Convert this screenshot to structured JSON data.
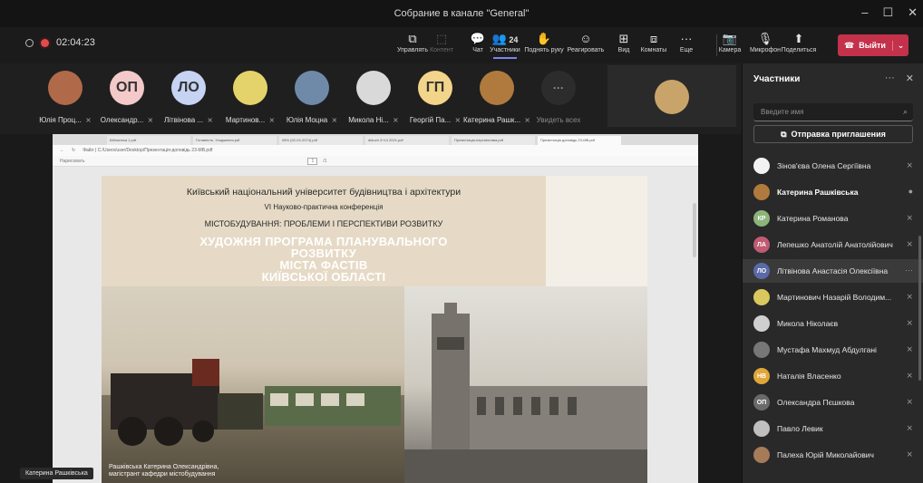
{
  "window": {
    "title": "Собрание в канале \"General\"",
    "controls": [
      "–",
      "☐",
      "✕"
    ]
  },
  "toolbar": {
    "timer": "02:04:23",
    "buttons": [
      {
        "label": "Управлять",
        "icon": "⧉",
        "active": false,
        "dim": false
      },
      {
        "label": "Контент",
        "icon": "⬚",
        "active": false,
        "dim": true
      },
      {
        "label": "Чат",
        "icon": "💬",
        "active": false,
        "dim": false
      },
      {
        "label": "Участники",
        "icon": "👥",
        "count": "24",
        "active": true,
        "dim": false
      },
      {
        "label": "Поднять руку",
        "icon": "✋",
        "active": false,
        "dim": false
      },
      {
        "label": "Реагировать",
        "icon": "☺",
        "active": false,
        "dim": false
      },
      {
        "label": "Вид",
        "icon": "⊞",
        "active": false,
        "dim": false
      },
      {
        "label": "Комнаты",
        "icon": "⧈",
        "active": false,
        "dim": false
      },
      {
        "label": "Еще",
        "icon": "···",
        "active": false,
        "dim": false
      },
      {
        "label": "Камера",
        "icon": "📷",
        "active": false,
        "dim": false
      },
      {
        "label": "Микрофон",
        "icon": "🎙",
        "active": false,
        "dim": false
      },
      {
        "label": "Поделиться",
        "icon": "⬆",
        "active": false,
        "dim": false
      }
    ],
    "leave_label": "Выйти"
  },
  "strip": {
    "participants": [
      {
        "name": "Юлія Проц...",
        "initials": "",
        "color": "#b06a4a"
      },
      {
        "name": "Олександр...",
        "initials": "ОП",
        "color": "#f3c9c9"
      },
      {
        "name": "Літвінова ...",
        "initials": "ЛО",
        "color": "#c6d3f2"
      },
      {
        "name": "Мартинов...",
        "initials": "",
        "color": "#e3d36a"
      },
      {
        "name": "Юлія Моцна",
        "initials": "",
        "color": "#6f8aa8"
      },
      {
        "name": "Микола Ні...",
        "initials": "",
        "color": "#d9d9d9"
      },
      {
        "name": "Георгій Па...",
        "initials": "ГП",
        "color": "#f2d48a"
      },
      {
        "name": "Катерина Рашк...",
        "initials": "",
        "color": "#b07a3e"
      }
    ],
    "more_label": "Увидеть всех"
  },
  "shared": {
    "tabs": [
      "Бібліотека 1.pdf",
      "Готовність. Уходження.pdf",
      "08% (02-02-2074).pdf",
      "diduch 3+14 2021.pdf",
      "Презентація-перспектива.pdf",
      "Презентація доповідь 23-MB.pdf"
    ],
    "address": "Файл  |  C:/Users/user/Desktop/Презентація-доповідь 23-MB.pdf",
    "pdf_zoom": "Нарисовать",
    "page_box": "1",
    "page_total": "/1",
    "slide": {
      "line1": "Київський національний університет будівництва і архітектури",
      "line2": "VI Науково-практична конференція",
      "line3": "МІСТОБУДУВАННЯ: ПРОБЛЕМИ І ПЕРСПЕКТИВИ РОЗВИТКУ",
      "headline": [
        "ХУДОЖНЯ ПРОГРАМА ПЛАНУВАЛЬНОГО",
        "РОЗВИТКУ",
        "МІСТА ФАСТІВ",
        "КИЇВСЬКОЇ ОБЛАСТІ"
      ],
      "caption": [
        "Рашківська Катерина Олександрівна,",
        "магістрант кафедри містобудування"
      ]
    },
    "presenter": "Катерина Рашківська"
  },
  "panel": {
    "title": "Участники",
    "search_placeholder": "Введите имя",
    "invite_label": "Отправка приглашения",
    "members": [
      {
        "name": "Зінов'єва Олена Сергіївна",
        "initials": "",
        "color": "#f2f2f2",
        "icon": "mic-off",
        "bold": false
      },
      {
        "name": "Катерина Рашківська",
        "initials": "",
        "color": "#b07a3e",
        "icon": "mic-on",
        "bold": true
      },
      {
        "name": "Катерина Романова",
        "initials": "КР",
        "color": "#8bb47a",
        "icon": "mic-off",
        "bold": false
      },
      {
        "name": "Лепешко Анатолій Анатолійович",
        "initials": "ЛА",
        "color": "#c15a73",
        "icon": "mic-off",
        "bold": false
      },
      {
        "name": "Літвінова Анастасія Олексіївна",
        "initials": "ЛО",
        "color": "#5a6aa8",
        "icon": "more",
        "bold": false
      },
      {
        "name": "Мартинович Назарій Володим...",
        "initials": "",
        "color": "#d8c85e",
        "icon": "mic-off",
        "bold": false
      },
      {
        "name": "Микола Ніколаєв",
        "initials": "",
        "color": "#cfcfcf",
        "icon": "mic-off",
        "bold": false
      },
      {
        "name": "Мустафа Махмуд Абдулгані",
        "initials": "",
        "color": "#777777",
        "icon": "mic-off",
        "bold": false
      },
      {
        "name": "Наталія Власенко",
        "initials": "НВ",
        "color": "#e0a63a",
        "icon": "mic-off",
        "bold": false
      },
      {
        "name": "Олександра Пєшкова",
        "initials": "ОП",
        "color": "#6a6a6a",
        "icon": "mic-off",
        "bold": false
      },
      {
        "name": "Павло Левик",
        "initials": "",
        "color": "#bfbfbf",
        "icon": "mic-off",
        "bold": false
      },
      {
        "name": "Палеха Юрій Миколайович",
        "initials": "",
        "color": "#a57b5a",
        "icon": "mic-off",
        "bold": false
      }
    ]
  }
}
